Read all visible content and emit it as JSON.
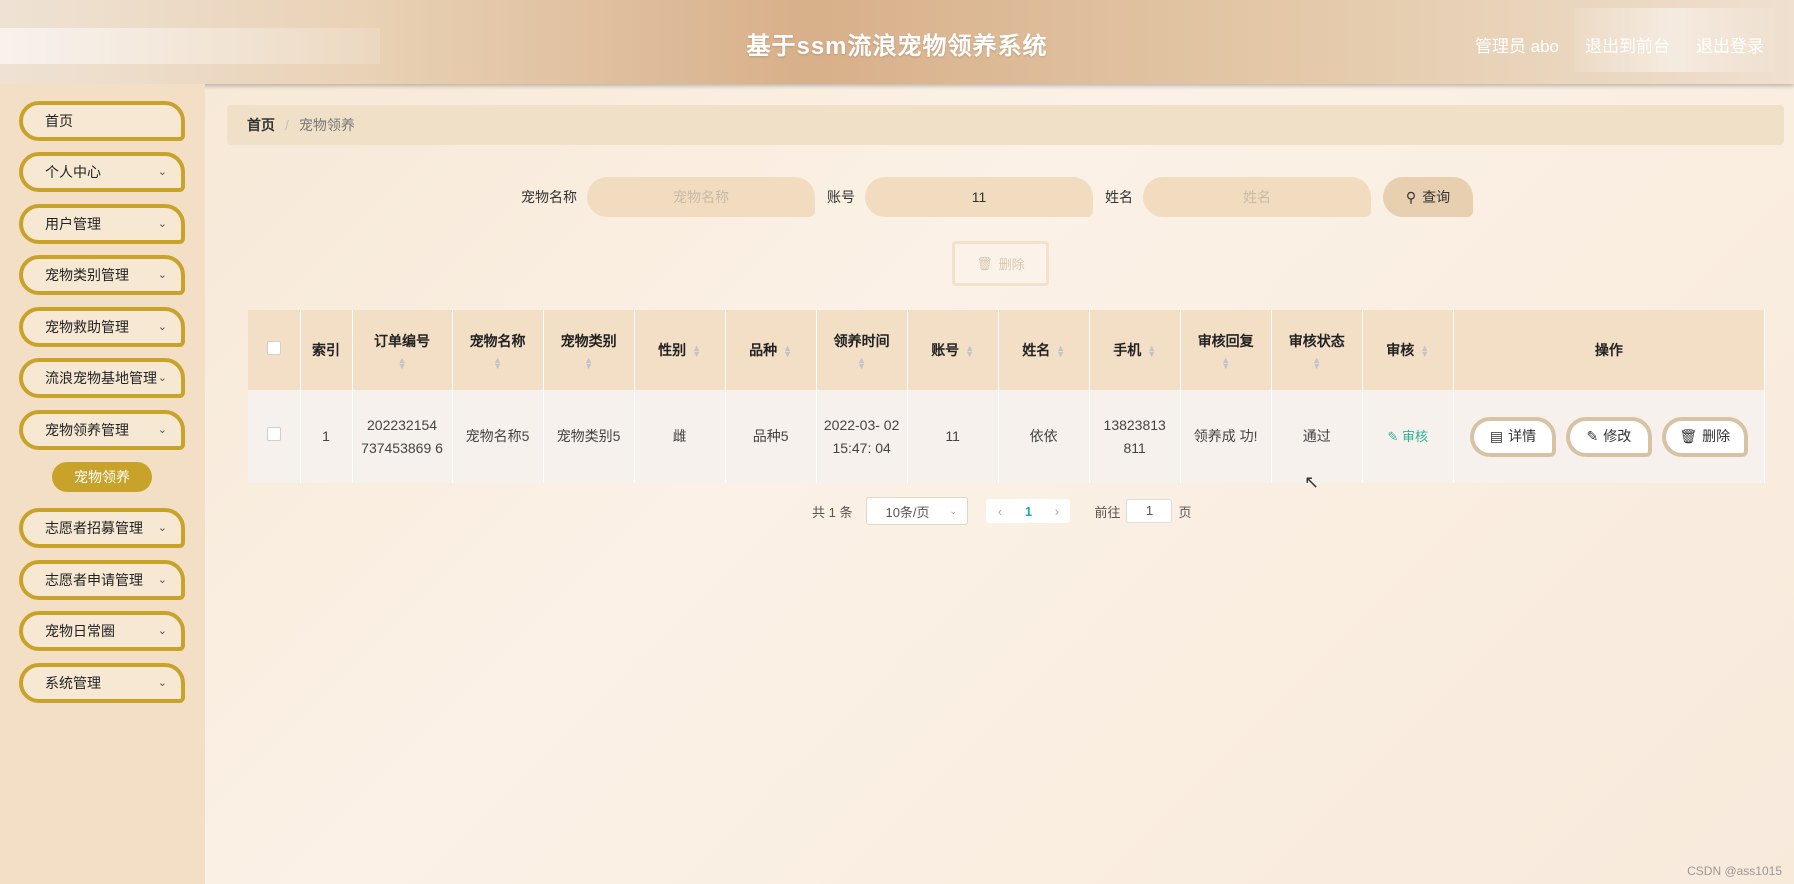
{
  "header": {
    "title": "基于ssm流浪宠物领养系统",
    "admin_label": "管理员 abo",
    "to_front": "退出到前台",
    "logout": "退出登录"
  },
  "sidebar": {
    "items": [
      {
        "label": "首页",
        "has_chevron": false
      },
      {
        "label": "个人中心",
        "has_chevron": true
      },
      {
        "label": "用户管理",
        "has_chevron": true
      },
      {
        "label": "宠物类别管理",
        "has_chevron": true
      },
      {
        "label": "宠物救助管理",
        "has_chevron": true
      },
      {
        "label": "流浪宠物基地管理",
        "has_chevron": true
      },
      {
        "label": "宠物领养管理",
        "has_chevron": true
      },
      {
        "label": "志愿者招募管理",
        "has_chevron": true
      },
      {
        "label": "志愿者申请管理",
        "has_chevron": true
      },
      {
        "label": "宠物日常圈",
        "has_chevron": true
      },
      {
        "label": "系统管理",
        "has_chevron": true
      }
    ],
    "active_sub": "宠物领养"
  },
  "breadcrumb": {
    "home": "首页",
    "separator": "/",
    "current": "宠物领养"
  },
  "search": {
    "pet_name_label": "宠物名称",
    "pet_name_placeholder": "宠物名称",
    "account_label": "账号",
    "account_value": "11",
    "name_label": "姓名",
    "name_placeholder": "姓名",
    "query_button": "查询"
  },
  "bulk_delete": "删除",
  "table": {
    "headers": [
      "索引",
      "订单编号",
      "宠物名称",
      "宠物类别",
      "性别",
      "品种",
      "领养时间",
      "账号",
      "姓名",
      "手机",
      "审核回复",
      "审核状态",
      "审核",
      "操作"
    ],
    "rows": [
      {
        "index": "1",
        "order_no": "202232154 737453869 6",
        "pet_name": "宠物名称5",
        "pet_category": "宠物类别5",
        "gender": "雌",
        "breed": "品种5",
        "adopt_time": "2022-03- 02 15:47: 04",
        "account": "11",
        "name": "依依",
        "phone": "13823813 811",
        "reply": "领养成 功!",
        "status": "通过",
        "audit": "审核",
        "actions": {
          "detail": "详情",
          "edit": "修改",
          "delete": "删除"
        }
      }
    ]
  },
  "pager": {
    "total": "共 1 条",
    "page_size": "10条/页",
    "current_page": "1",
    "goto_label": "前往",
    "goto_value": "1",
    "page_suffix": "页"
  },
  "watermark": "CSDN @ass1015",
  "colors": {
    "accent": "#c9a22a",
    "audit_link": "#2bb39a",
    "pager_active": "#2aa3b8"
  }
}
